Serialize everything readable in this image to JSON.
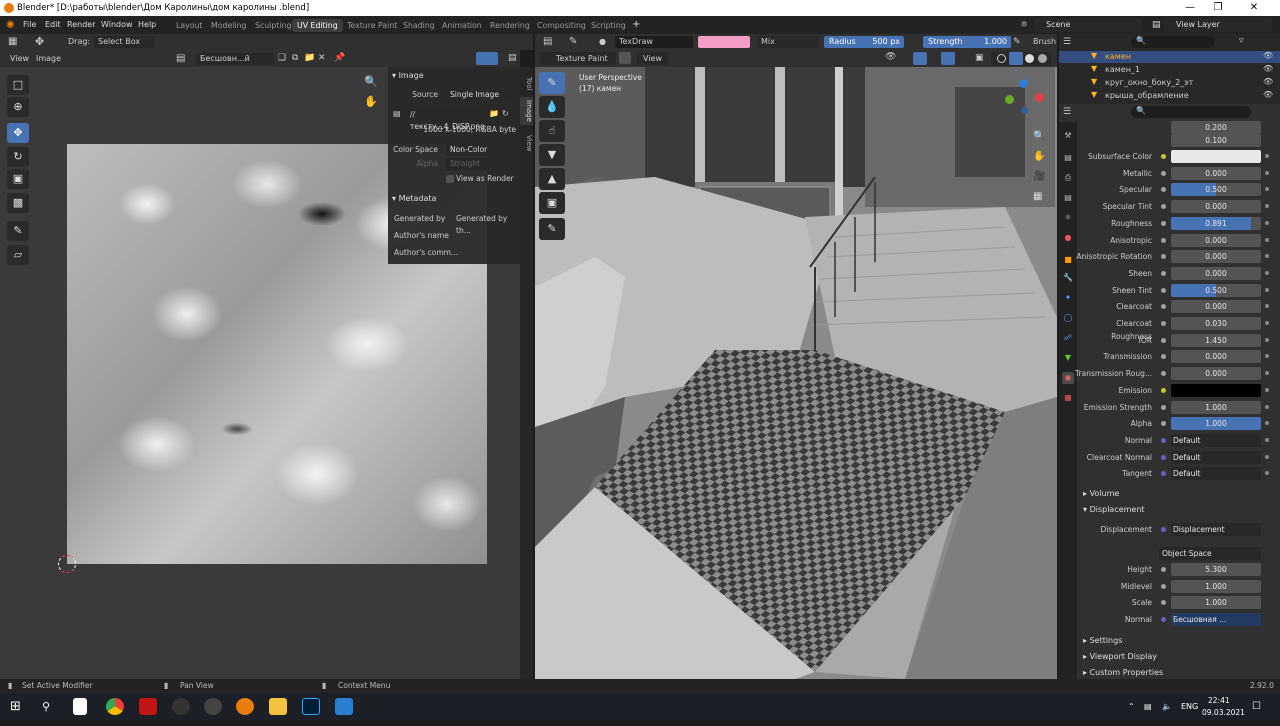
{
  "window": {
    "title": "Blender* [D:\\работы\\blender\\Дом Каролины\\дом каролины .blend]"
  },
  "menu": [
    "File",
    "Edit",
    "Render",
    "Window",
    "Help"
  ],
  "workspaces": [
    "Layout",
    "Modeling",
    "Sculpting",
    "UV Editing",
    "Texture Paint",
    "Shading",
    "Animation",
    "Rendering",
    "Compositing",
    "Scripting"
  ],
  "active_workspace": "UV Editing",
  "scene": {
    "name": "Scene",
    "view_layer": "View Layer"
  },
  "uv_editor": {
    "drag_label": "Drag:",
    "drag_mode": "Select Box",
    "menu": [
      "View",
      "Image"
    ],
    "image_name": "Бесшовн...й кла.001",
    "side_tabs": [
      "Tool",
      "Image",
      "View"
    ],
    "image_panel": {
      "title": "Image",
      "source_label": "Source",
      "source_value": "Single Image",
      "filepath": "//тексту...4_DISP.png",
      "info": "1000 x 1000,  RGBA byte",
      "color_space_label": "Color Space",
      "color_space_value": "Non-Color",
      "alpha_label": "Alpha",
      "alpha_value": "Straight",
      "view_as_render": "View as Render"
    },
    "metadata_panel": {
      "title": "Metadata",
      "generated_by_label": "Generated by",
      "generated_by_value": "Generated by th...",
      "authors_name": "Author's name",
      "authors_comment": "Author's comm..."
    }
  },
  "viewport": {
    "mode": "Texture Paint",
    "brush": "TexDraw",
    "blend": "Mix",
    "radius_label": "Radius",
    "radius_value": "500 px",
    "strength_label": "Strength",
    "strength_value": "1.000",
    "brush_label": "Brush",
    "view_menu": "View",
    "perspective": "User Perspective",
    "object": "(17) камен",
    "brush_color": "#f29cc6"
  },
  "outliner": {
    "items": [
      "камен",
      "камен_1",
      "круг_окно_боку_2_эт",
      "крыша_обрамление"
    ]
  },
  "properties": {
    "top_values": [
      "0.200",
      "0.100"
    ],
    "rows": [
      {
        "label": "Subsurface Color",
        "value": "",
        "type": "color",
        "color": "#e8e8e8"
      },
      {
        "label": "Metallic",
        "value": "0.000",
        "fill": 0
      },
      {
        "label": "Specular",
        "value": "0.500",
        "fill": 0.5
      },
      {
        "label": "Specular Tint",
        "value": "0.000",
        "fill": 0
      },
      {
        "label": "Roughness",
        "value": "0.891",
        "fill": 0.891
      },
      {
        "label": "Anisotropic",
        "value": "0.000",
        "fill": 0
      },
      {
        "label": "Anisotropic Rotation",
        "value": "0.000",
        "fill": 0
      },
      {
        "label": "Sheen",
        "value": "0.000",
        "fill": 0
      },
      {
        "label": "Sheen Tint",
        "value": "0.500",
        "fill": 0.5
      },
      {
        "label": "Clearcoat",
        "value": "0.000",
        "fill": 0
      },
      {
        "label": "Clearcoat Roughness",
        "value": "0.030",
        "fill": 0
      },
      {
        "label": "IOR",
        "value": "1.450",
        "fill": 0
      },
      {
        "label": "Transmission",
        "value": "0.000",
        "fill": 0
      },
      {
        "label": "Transmission Roug...",
        "value": "0.000",
        "fill": 0
      },
      {
        "label": "Emission",
        "value": "",
        "type": "color",
        "color": "#000000"
      },
      {
        "label": "Emission Strength",
        "value": "1.000",
        "fill": 0
      },
      {
        "label": "Alpha",
        "value": "1.000",
        "fill": 1
      },
      {
        "label": "Normal",
        "value": "Default",
        "type": "link"
      },
      {
        "label": "Clearcoat Normal",
        "value": "Default",
        "type": "link"
      },
      {
        "label": "Tangent",
        "value": "Default",
        "type": "link"
      }
    ],
    "volume": "Volume",
    "displacement_section": "Displacement",
    "displacement_label": "Displacement",
    "displacement_value": "Displacement",
    "space": "Object Space",
    "disp_rows": [
      {
        "label": "Height",
        "value": "5.300"
      },
      {
        "label": "Midlevel",
        "value": "1.000"
      },
      {
        "label": "Scale",
        "value": "1.000"
      },
      {
        "label": "Normal",
        "value": "Бесшовная ..."
      }
    ],
    "sections": [
      "Settings",
      "Viewport Display",
      "Custom Properties"
    ]
  },
  "status": {
    "left": "Set Active Modifier",
    "mid": "Pan View",
    "right": "Context Menu",
    "version": "2.92.0"
  },
  "taskbar": {
    "time": "22:41",
    "date": "09.03.2021",
    "lang": "ENG"
  }
}
